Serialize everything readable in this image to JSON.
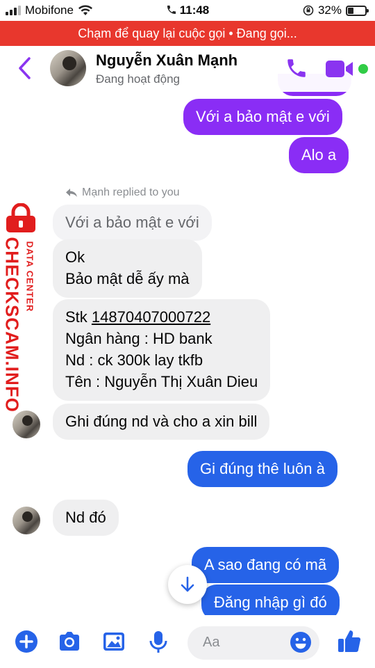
{
  "status_bar": {
    "carrier": "Mobifone",
    "time": "11:48",
    "battery": "32%"
  },
  "call_banner": "Chạm để quay lại cuộc gọi • Đang gọi...",
  "header": {
    "name": "Nguyễn Xuân Mạnh",
    "status": "Đang hoạt động"
  },
  "watermark": {
    "title": "CHECKSCAM.INFO",
    "subtitle": "DATA CENTER"
  },
  "messages": {
    "m1": "Với a bảo mật e với",
    "m2": "Alo a",
    "reply_note": "Mạnh replied to you",
    "quote": "Với a bảo mật e với",
    "m3_line1": "Ok",
    "m3_line2": "Bảo mật dễ ấy mà",
    "m4_stk_label": "Stk ",
    "m4_stk_value": "14870407000722",
    "m4_line2": "Ngân hàng : HD bank",
    "m4_line3": "Nd : ck 300k lay tkfb",
    "m4_line4": "Tên : Nguyễn Thị Xuân Dieu",
    "m5": "Ghi đúng nd và cho a xin bill",
    "m6": "Gi đúng thê luôn à",
    "m7": "Nd đó",
    "m8": "A sao đang có mã",
    "m9": "Đăng nhập gì đó"
  },
  "composer": {
    "placeholder": "Aa"
  },
  "colors": {
    "accent_purple": "#8a2df5",
    "accent_blue": "#2663e8",
    "call_banner": "#e8372d",
    "watermark": "#e11d1d",
    "online": "#31cc46"
  }
}
